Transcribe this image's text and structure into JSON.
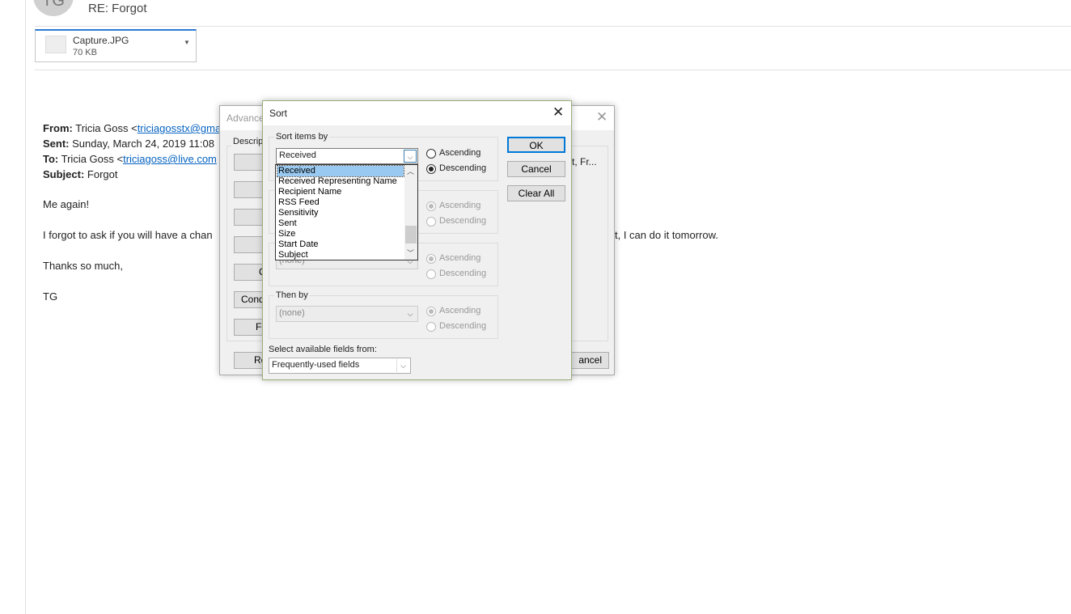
{
  "email": {
    "avatar_initials": "TG",
    "subject": "RE: Forgot",
    "attachment": {
      "name": "Capture.JPG",
      "size": "70 KB"
    },
    "from_label": "From:",
    "from_name": "Tricia Goss <",
    "from_email": "triciagosstx@gma",
    "sent_label": "Sent:",
    "sent_value": "Sunday, March 24, 2019 11:08",
    "to_label": "To:",
    "to_name": "Tricia Goss <",
    "to_email": "triciagoss@live.com",
    "subject_label": "Subject:",
    "subject_value": "Forgot",
    "body": [
      "Me again!",
      "I forgot to ask if you will have a chan",
      "t, I can do it tomorrow.",
      "Thanks so much,",
      "TG"
    ]
  },
  "advanced_dialog": {
    "title": "Advance",
    "description_label": "Descrip",
    "right_text": "t, Fr...",
    "buttons": [
      "C",
      "Cond",
      "Fo",
      "Re",
      "ancel"
    ]
  },
  "sort_dialog": {
    "title": "Sort",
    "sort_items_by_label": "Sort items by",
    "primary_field": "Received",
    "then_by_label": "Then by",
    "none_value": "(none)",
    "ascending": "Ascending",
    "descending": "Descending",
    "dropdown_items": [
      "Received",
      "Received Representing Name",
      "Recipient Name",
      "RSS Feed",
      "Sensitivity",
      "Sent",
      "Size",
      "Start Date",
      "Subject"
    ],
    "selected_item": "Received",
    "ok": "OK",
    "cancel": "Cancel",
    "clear_all": "Clear All",
    "fields_from_label": "Select available fields from:",
    "fields_from_value": "Frequently-used fields"
  }
}
